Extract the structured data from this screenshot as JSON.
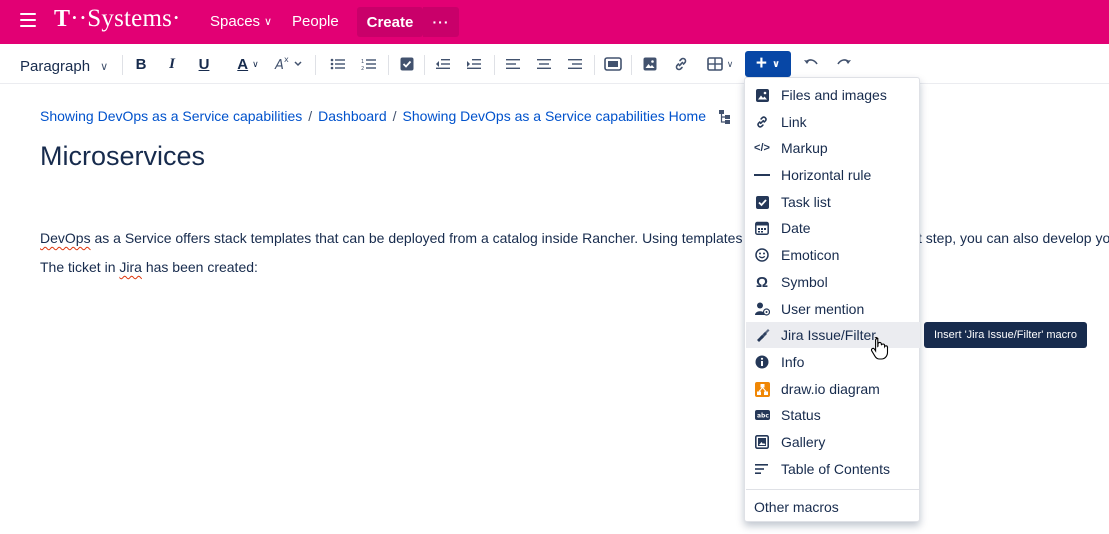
{
  "nav": {
    "logo_t": "T",
    "logo_text": "··Systems·",
    "spaces": "Spaces",
    "people": "People",
    "create": "Create",
    "more": "···",
    "brand_color": "#e20074"
  },
  "toolbar": {
    "paragraph": "Paragraph",
    "bold": "B",
    "italic": "I",
    "underline": "U",
    "text_color": "A",
    "plus": "+"
  },
  "breadcrumb": {
    "items": [
      "Showing DevOps as a Service capabilities",
      "Dashboard",
      "Showing DevOps as a Service capabilities Home"
    ],
    "separator": "/"
  },
  "page": {
    "title": "Microservices",
    "para1_link": "DevOps",
    "para1_text": " as a Service offers stack templates that can be deployed from a catalog inside Rancher. Using templates",
    "para1_tail": "t step, you can also develop yo",
    "para2_before": "The ticket in ",
    "para2_link": "Jira",
    "para2_after": " has been created:"
  },
  "menu": {
    "items": [
      {
        "label": "Files and images",
        "icon": "image-icon"
      },
      {
        "label": "Link",
        "icon": "link-icon"
      },
      {
        "label": "Markup",
        "icon": "code-icon"
      },
      {
        "label": "Horizontal rule",
        "icon": "horizontal-rule-icon"
      },
      {
        "label": "Task list",
        "icon": "task-checkbox-icon"
      },
      {
        "label": "Date",
        "icon": "calendar-icon"
      },
      {
        "label": "Emoticon",
        "icon": "emoticon-icon"
      },
      {
        "label": "Symbol",
        "icon": "omega-icon"
      },
      {
        "label": "User mention",
        "icon": "user-mention-icon"
      },
      {
        "label": "Jira Issue/Filter",
        "icon": "jira-icon"
      },
      {
        "label": "Info",
        "icon": "info-icon"
      },
      {
        "label": "draw.io diagram",
        "icon": "drawio-icon"
      },
      {
        "label": "Status",
        "icon": "status-lozenge-icon"
      },
      {
        "label": "Gallery",
        "icon": "gallery-icon"
      },
      {
        "label": "Table of Contents",
        "icon": "toc-icon"
      }
    ],
    "other": "Other macros",
    "hovered_index": 9
  },
  "tooltip": "Insert 'Jira Issue/Filter' macro"
}
